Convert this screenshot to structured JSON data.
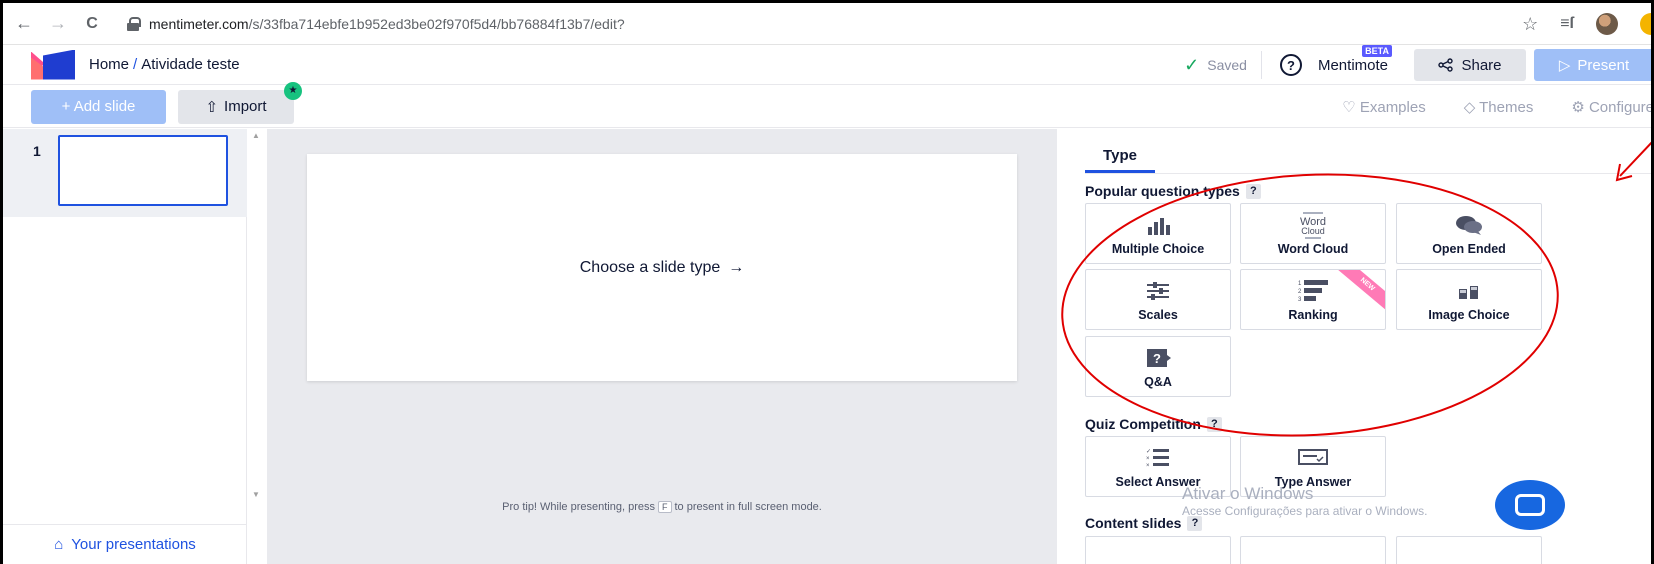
{
  "browser": {
    "back": "←",
    "forward": "→",
    "reload": "C",
    "url_host": "mentimeter.com",
    "url_path": "/s/33fba714ebfe1b952ed3be02f970f5d4/bb76884f13b7/edit?",
    "star": "☆",
    "queue": "≡ſ"
  },
  "header": {
    "home": "Home",
    "separator": "/",
    "presentation_name": "Atividade teste",
    "saved": "Saved",
    "help": "?",
    "mentimote": "Mentimote",
    "beta": "BETA",
    "share": "Share",
    "present": "Present"
  },
  "toolbar": {
    "add_slide": "+ Add slide",
    "import": "Import",
    "examples": "Examples",
    "themes": "Themes",
    "configure": "Configure"
  },
  "slides": {
    "items": [
      {
        "number": "1"
      }
    ],
    "your_presentations": "Your presentations"
  },
  "canvas": {
    "choose": "Choose a slide type",
    "arrow": "→",
    "tip_pre": "Pro tip! While presenting, press",
    "tip_key": "F",
    "tip_post": "to present in full screen mode."
  },
  "panel": {
    "tab": "Type",
    "popular_title": "Popular question types",
    "popular": [
      "Multiple Choice",
      "Word Cloud",
      "Open Ended",
      "Scales",
      "Ranking",
      "Image Choice",
      "Q&A"
    ],
    "new_badge": "NEW",
    "quiz_title": "Quiz Competition",
    "quiz": [
      "Select Answer",
      "Type Answer"
    ],
    "content_title": "Content slides",
    "qmark": "?"
  },
  "overlay": {
    "watermark_title": "Ativar o Windows",
    "watermark_sub": "Acesse Configurações para ativar o Windows."
  },
  "colors": {
    "accent": "#1f52e0",
    "annotation": "#e00000",
    "new_ribbon": "#ff7ab6"
  }
}
